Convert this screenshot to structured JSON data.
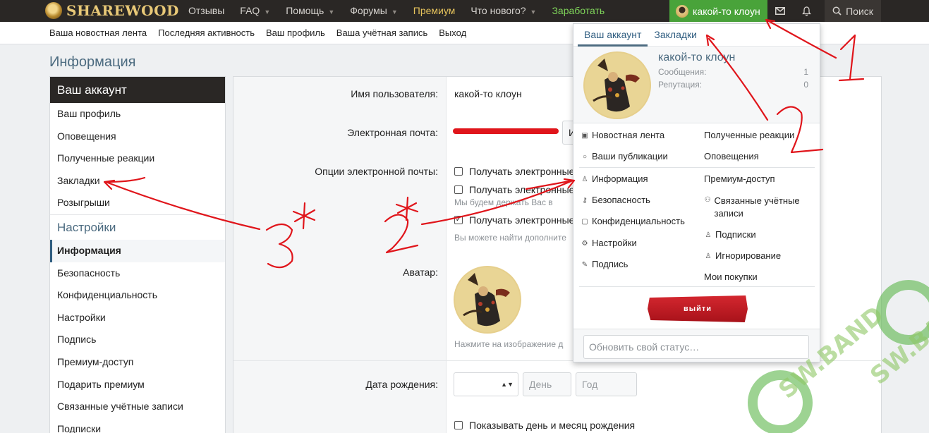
{
  "header": {
    "logo_text": "SHAREWOOD",
    "nav": [
      {
        "label": "Отзывы",
        "caret": false,
        "style": "normal"
      },
      {
        "label": "FAQ",
        "caret": true,
        "style": "normal"
      },
      {
        "label": "Помощь",
        "caret": true,
        "style": "normal"
      },
      {
        "label": "Форумы",
        "caret": true,
        "style": "normal"
      },
      {
        "label": "Премиум",
        "caret": false,
        "style": "premium"
      },
      {
        "label": "Что нового?",
        "caret": true,
        "style": "normal"
      },
      {
        "label": "Заработать",
        "caret": false,
        "style": "earn"
      }
    ],
    "account_name": "какой-то клоун",
    "search_label": "Поиск"
  },
  "subnav": [
    "Ваша новостная лента",
    "Последняя активность",
    "Ваш профиль",
    "Ваша учётная запись",
    "Выход"
  ],
  "page_title": "Информация",
  "sidebar": {
    "account_title": "Ваш аккаунт",
    "account_items": [
      "Ваш профиль",
      "Оповещения",
      "Полученные реакции",
      "Закладки",
      "Розыгрыши"
    ],
    "settings_title": "Настройки",
    "settings_items": [
      "Информация",
      "Безопасность",
      "Конфиденциальность",
      "Настройки",
      "Подпись",
      "Премиум-доступ",
      "Подарить премиум",
      "Связанные учётные записи",
      "Подписки"
    ],
    "active_item": "Информация"
  },
  "form": {
    "username_label": "Имя пользователя:",
    "username_value": "какой-то клоун",
    "email_label": "Электронная почта:",
    "email_options_label": "Опции электронной почты:",
    "email_options": [
      {
        "label": "Получать электронные",
        "checked": false
      },
      {
        "label": "Получать электронные",
        "checked": false
      },
      {
        "label": "Получать электронные",
        "checked": true
      }
    ],
    "hint_1": "Мы будем держать Вас в",
    "hint_2": "Вы можете найти дополните",
    "avatar_label": "Аватар:",
    "avatar_hint": "Нажмите на изображение д",
    "birthday_label": "Дата рождения:",
    "day_placeholder": "День",
    "year_placeholder": "Год",
    "show_birthday_label": "Показывать день и месяц рождения",
    "email_button_fragment": "И"
  },
  "menu": {
    "tabs": [
      "Ваш аккаунт",
      "Закладки"
    ],
    "active_tab": "Ваш аккаунт",
    "username": "какой-то клоун",
    "stats": [
      {
        "label": "Сообщения:",
        "value": "1"
      },
      {
        "label": "Репутация:",
        "value": "0"
      }
    ],
    "left_items": [
      {
        "icon": "rss-icon",
        "label": "Новостная лента"
      },
      {
        "icon": "comment-icon",
        "label": "Ваши публикации"
      },
      {
        "icon": "user-icon",
        "label": "Информация"
      },
      {
        "icon": "key-icon",
        "label": "Безопасность"
      },
      {
        "icon": "lock-icon",
        "label": "Конфиденциальность"
      },
      {
        "icon": "cogs-icon",
        "label": "Настройки"
      },
      {
        "icon": "pen-icon",
        "label": "Подпись"
      }
    ],
    "right_items": [
      {
        "icon": "",
        "label": "Полученные реакции"
      },
      {
        "icon": "",
        "label": "Оповещения"
      },
      {
        "icon": "",
        "label": "Премиум-доступ"
      },
      {
        "icon": "users-icon",
        "label": "Связанные учётные записи"
      },
      {
        "icon": "user-plus-icon",
        "label": "Подписки"
      },
      {
        "icon": "user-times-icon",
        "label": "Игнорирование"
      },
      {
        "icon": "",
        "label": "Мои покупки"
      }
    ],
    "logout_label": "выйти",
    "status_placeholder": "Обновить свой статус…"
  },
  "watermark": [
    "SW.BAND",
    "SW.BAND"
  ],
  "annotations": [
    "1",
    "2",
    "3*",
    "2*"
  ],
  "colors": {
    "topbar": "#2a2725",
    "account_green": "#49a33a",
    "premium": "#e6c35c",
    "earn": "#7fd35a",
    "accent": "#4c6b80",
    "annotation_red": "#e0151b"
  }
}
